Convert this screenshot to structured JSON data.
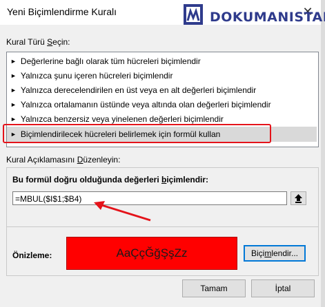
{
  "window": {
    "title": "Yeni Biçimlendirme Kuralı",
    "close_symbol": "✕"
  },
  "watermark": {
    "text": "DOKUMANISTAN",
    "icon": "document-logo-icon",
    "color": "#2f3b8c"
  },
  "rule_type": {
    "label_prefix": "Kural Türü ",
    "label_accel": "S",
    "label_suffix": "eçin:",
    "items": [
      {
        "label": "Değerlerine bağlı olarak tüm hücreleri biçimlendir"
      },
      {
        "label": "Yalnızca şunu içeren hücreleri biçimlendir"
      },
      {
        "label": "Yalnızca derecelendirilen en üst veya en alt değerleri biçimlendir"
      },
      {
        "label": "Yalnızca ortalamanın üstünde veya altında olan değerleri biçimlendir"
      },
      {
        "label": "Yalnızca benzersiz veya yinelenen değerleri biçimlendir"
      },
      {
        "label": "Biçimlendirilecek hücreleri belirlemek için formül kullan"
      }
    ],
    "selected_index": 5
  },
  "description": {
    "label_prefix": "Kural Açıklamasını ",
    "label_accel": "D",
    "label_suffix": "üzenleyin:",
    "formula_label_prefix": "Bu formül doğru olduğunda değerleri ",
    "formula_label_accel": "b",
    "formula_label_suffix": "içimlendir:",
    "formula_value": "=MBUL($I$1;$B4)",
    "preview_label": "Önizleme:",
    "preview_text": "AaÇçĞğŞşZz",
    "preview_color": "#ff0000",
    "format_button_prefix": "Biçi",
    "format_button_accel": "m",
    "format_button_suffix": "lendir..."
  },
  "footer": {
    "ok_label": "Tamam",
    "cancel_label": "İptal"
  },
  "annotations": {
    "highlight_color": "#e4131a"
  }
}
